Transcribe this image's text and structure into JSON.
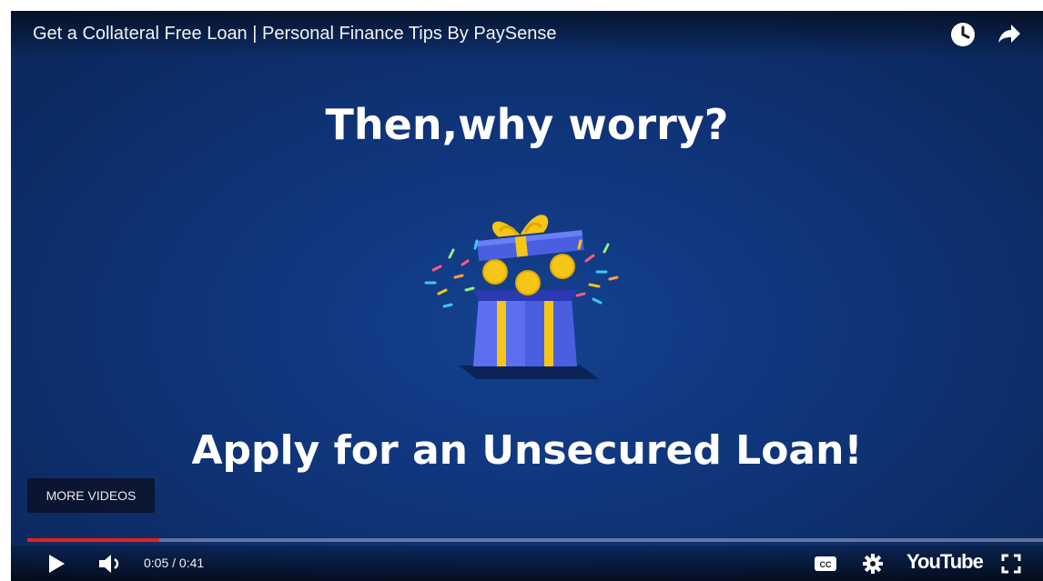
{
  "video": {
    "title": "Get a Collateral Free Loan | Personal Finance Tips By PaySense",
    "headline_top": "Then,why worry?",
    "headline_bottom": "Apply for an Unsecured Loan!"
  },
  "top_actions": {
    "icons": [
      "watch-later-icon",
      "share-icon"
    ]
  },
  "overlay": {
    "more_videos_label": "MORE VIDEOS"
  },
  "playback": {
    "current_time": "0:05",
    "duration": "0:41",
    "time_display": "0:05 / 0:41",
    "progress_fraction": 0.13
  },
  "controls": {
    "left_icons": [
      "play-icon",
      "volume-icon"
    ],
    "right_icons": [
      "captions-icon",
      "settings-icon",
      "youtube-logo",
      "fullscreen-icon"
    ],
    "youtube_label": "YouTube"
  },
  "colors": {
    "background": "#0f3479",
    "progress": "#e62117",
    "gift_box": "#4a5fe0",
    "ribbon": "#f5c518"
  }
}
